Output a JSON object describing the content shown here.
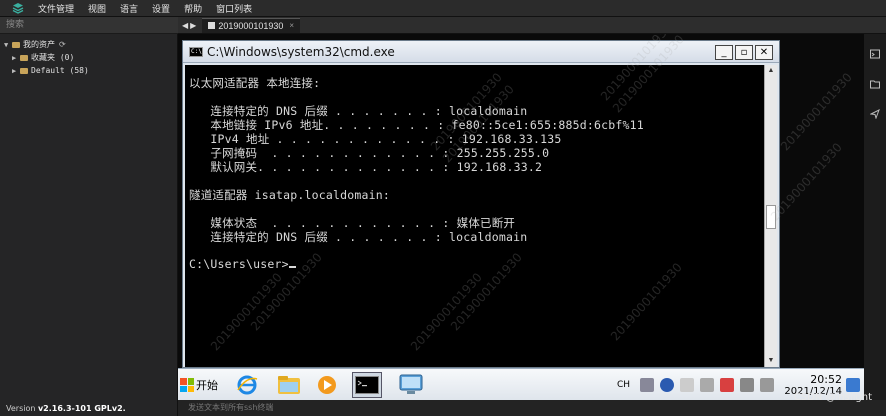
{
  "menu": {
    "items": [
      "文件管理",
      "视图",
      "语言",
      "设置",
      "帮助",
      "窗口列表"
    ]
  },
  "sidebar": {
    "search_placeholder": "搜索",
    "root_label": "我的资产",
    "groups": [
      {
        "label": "收藏夹 (0)"
      },
      {
        "label": "Default (58)"
      }
    ],
    "version_prefix": "Version",
    "version_value": "v2.16.3-101 GPLv2."
  },
  "tabs": {
    "active_label": "2019000101930",
    "close_glyph": "×"
  },
  "cmd": {
    "title": "C:\\Windows\\system32\\cmd.exe",
    "lines": [
      "以太网适配器 本地连接:",
      "",
      "   连接特定的 DNS 后缀 . . . . . . . : localdomain",
      "   本地链接 IPv6 地址. . . . . . . . : fe80::5ce1:655:885d:6cbf%11",
      "   IPv4 地址 . . . . . . . . . . . . : 192.168.33.135",
      "   子网掩码  . . . . . . . . . . . . : 255.255.255.0",
      "   默认网关. . . . . . . . . . . . . : 192.168.33.2",
      "",
      "隧道适配器 isatap.localdomain:",
      "",
      "   媒体状态  . . . . . . . . . . . . : 媒体已断开",
      "   连接特定的 DNS 后缀 . . . . . . . : localdomain",
      "",
      "C:\\Users\\user>"
    ]
  },
  "watermark": {
    "text": "2019000101930"
  },
  "taskbar": {
    "start_label": "开始",
    "input_lang": "CH",
    "time": "20:52",
    "date": "2021/12/14"
  },
  "bottom": {
    "hint": "发送文本到所有ssh终端",
    "credit": "CSDN @inslight"
  }
}
